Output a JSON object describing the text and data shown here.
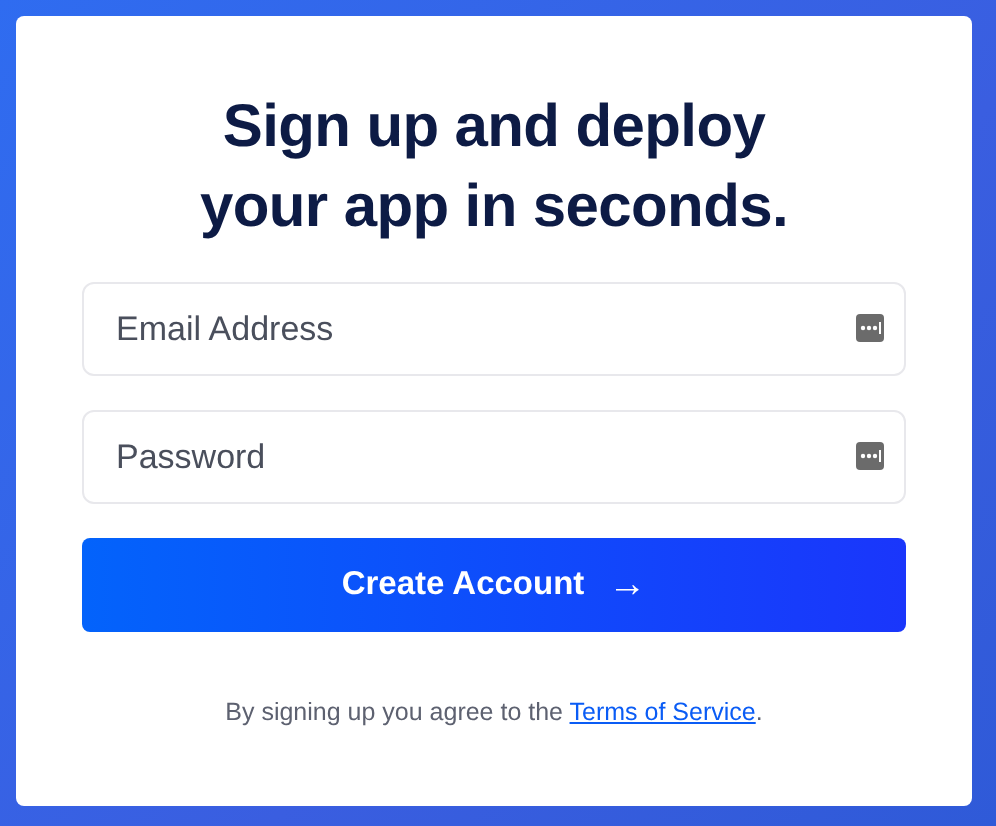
{
  "headline": "Sign up and deploy your app in seconds.",
  "fields": [
    {
      "placeholder": "Email Address"
    },
    {
      "placeholder": "Password"
    }
  ],
  "submit_button": {
    "label": "Create Account",
    "icon": "→"
  },
  "legal": {
    "before": "By signing up you agree to the ",
    "link": "Terms of Service",
    "after": "."
  }
}
